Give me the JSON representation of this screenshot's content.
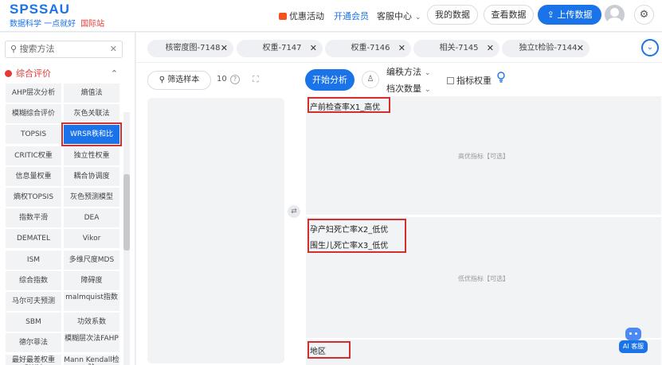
{
  "brand": {
    "name": "SPSSAU",
    "slogan": "数据科学 一点就好",
    "intl": "国际站"
  },
  "nav": {
    "promo": "优惠活动",
    "vip": "开通会员",
    "cs": "客服中心",
    "my_data": "我的数据",
    "view_data": "查看数据",
    "upload": "上传数据"
  },
  "sidebar": {
    "search_placeholder": "搜索方法",
    "category": "综合评价",
    "methods": [
      "AHP层次分析",
      "熵值法",
      "模糊综合评价",
      "灰色关联法",
      "TOPSIS",
      "WRSR秩和比",
      "CRITIC权重",
      "独立性权重",
      "信息量权重",
      "耦合协调度",
      "熵权TOPSIS",
      "灰色预测模型",
      "指数平滑",
      "DEA",
      "DEMATEL",
      "Vikor",
      "ISM",
      "多维尺度MDS",
      "综合指数",
      "障碍度",
      "马尔可夫预测",
      "malmquist指数",
      "SBM",
      "功效系数",
      "德尔菲法",
      "模糊层次法FAHP",
      "最好最差权重BWM",
      "Mann Kendall检验"
    ],
    "active_method": "WRSR秩和比"
  },
  "tabs": [
    "核密度图-7148",
    "权重-7147",
    "权重-7146",
    "相关-7145",
    "独立t检验-7144"
  ],
  "left_panel": {
    "filter_label": "筛选样本",
    "count": "10"
  },
  "toolbar": {
    "start": "开始分析",
    "method_label": "编秩方法",
    "levels_label": "档次数量",
    "weight_label": "指标权重"
  },
  "zones": {
    "high": {
      "hint": "高优指标【可选】",
      "vars": [
        "产前检查率X1_高优"
      ]
    },
    "low": {
      "hint": "低优指标【可选】",
      "vars": [
        "孕产妇死亡率X2_低优",
        "围生儿死亡率X3_低优"
      ]
    },
    "region": {
      "vars": [
        "地区"
      ]
    }
  },
  "ai": {
    "label": "AI 客服"
  },
  "colors": {
    "accent": "#1a73e8",
    "highlight": "#d32f2f",
    "promo": "#f4511e"
  }
}
